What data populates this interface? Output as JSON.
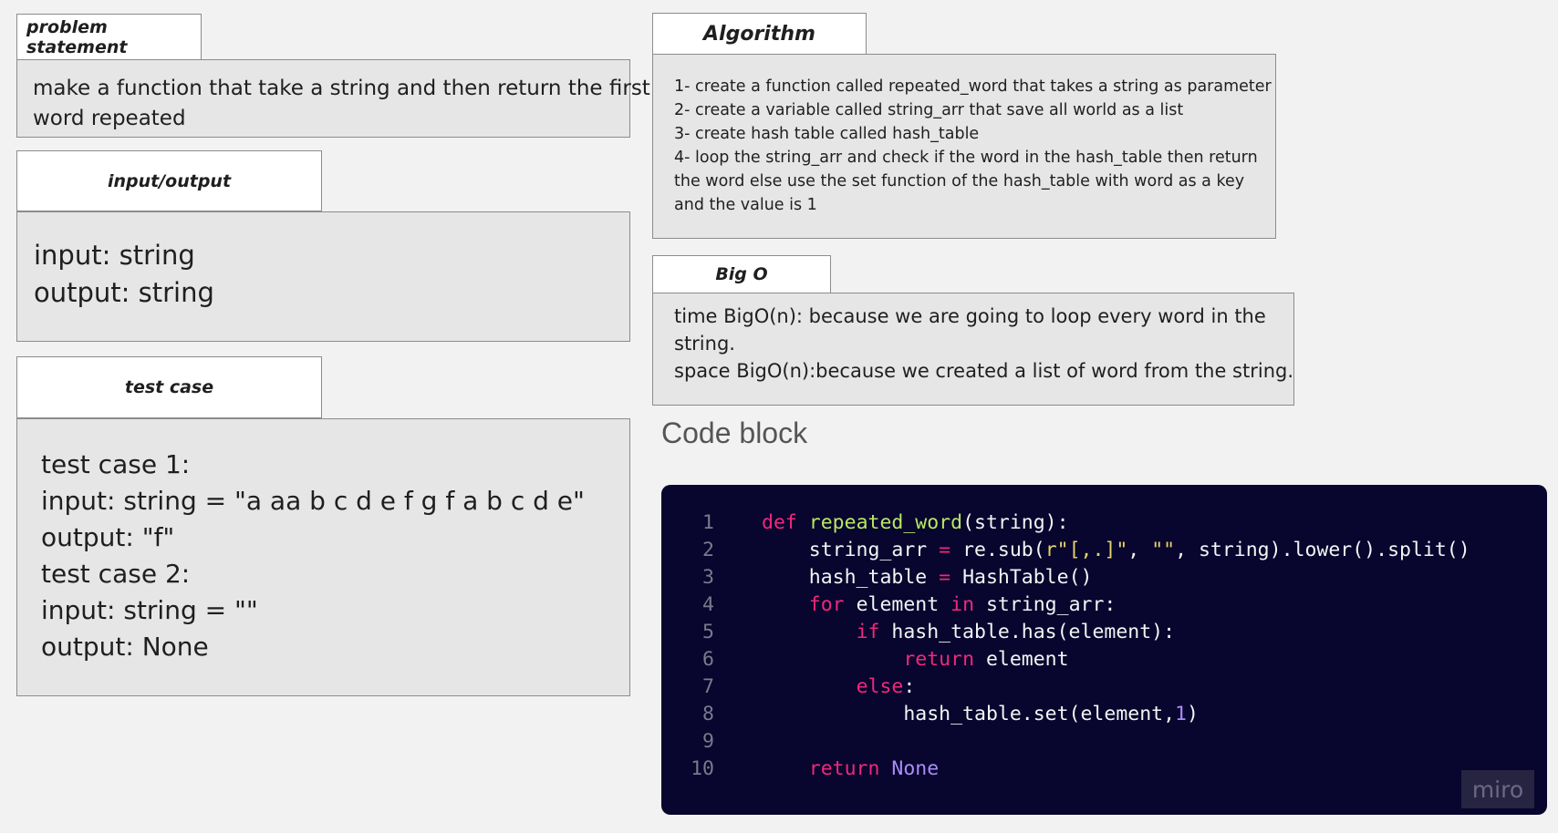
{
  "problem_statement": {
    "title": "problem statement",
    "lines": [
      "make a function that take a string and then return the first",
      "word repeated"
    ]
  },
  "input_output": {
    "title": "input/output",
    "lines": [
      "input: string",
      "output: string"
    ]
  },
  "test_case": {
    "title": "test case",
    "lines": [
      "test case 1:",
      "input: string = \"a aa b c d e f g f a b c d e\"",
      "output: \"f\"",
      "test case 2:",
      "input: string = \"\"",
      "output: None"
    ]
  },
  "algorithm": {
    "title": "Algorithm",
    "lines": [
      "1- create a function called repeated_word that takes a string as parameter",
      "2- create a variable called string_arr that save all world as a list",
      "3- create hash table called hash_table",
      "4- loop the string_arr and check if the word in the hash_table then return",
      "the word else use the set function of the hash_table with word as a key",
      "and the value is 1"
    ]
  },
  "big_o": {
    "title": "Big O",
    "lines": [
      "time BigO(n): because we are going to loop every word in the",
      "string.",
      "space BigO(n):because we created a list of word from the string."
    ]
  },
  "code_block": {
    "heading": "Code block",
    "lines": [
      {
        "no": "1",
        "tokens": [
          {
            "t": "kw",
            "s": "def"
          },
          {
            "t": "plain",
            "s": " "
          },
          {
            "t": "fn",
            "s": "repeated_word"
          },
          {
            "t": "plain",
            "s": "(string):"
          }
        ]
      },
      {
        "no": "2",
        "tokens": [
          {
            "t": "plain",
            "s": "    string_arr "
          },
          {
            "t": "op",
            "s": "="
          },
          {
            "t": "plain",
            "s": " re.sub("
          },
          {
            "t": "str",
            "s": "r\"[,.]\""
          },
          {
            "t": "plain",
            "s": ", "
          },
          {
            "t": "str",
            "s": "\"\""
          },
          {
            "t": "plain",
            "s": ", string).lower().split()"
          }
        ]
      },
      {
        "no": "3",
        "tokens": [
          {
            "t": "plain",
            "s": "    hash_table "
          },
          {
            "t": "op",
            "s": "="
          },
          {
            "t": "plain",
            "s": " HashTable()"
          }
        ]
      },
      {
        "no": "4",
        "tokens": [
          {
            "t": "plain",
            "s": "    "
          },
          {
            "t": "kw",
            "s": "for"
          },
          {
            "t": "plain",
            "s": " element "
          },
          {
            "t": "kw",
            "s": "in"
          },
          {
            "t": "plain",
            "s": " string_arr:"
          }
        ]
      },
      {
        "no": "5",
        "tokens": [
          {
            "t": "plain",
            "s": "        "
          },
          {
            "t": "kw",
            "s": "if"
          },
          {
            "t": "plain",
            "s": " hash_table.has(element):"
          }
        ]
      },
      {
        "no": "6",
        "tokens": [
          {
            "t": "plain",
            "s": "            "
          },
          {
            "t": "kw",
            "s": "return"
          },
          {
            "t": "plain",
            "s": " element"
          }
        ]
      },
      {
        "no": "7",
        "tokens": [
          {
            "t": "plain",
            "s": "        "
          },
          {
            "t": "kw",
            "s": "else"
          },
          {
            "t": "plain",
            "s": ":"
          }
        ]
      },
      {
        "no": "8",
        "tokens": [
          {
            "t": "plain",
            "s": "            hash_table.set(element,"
          },
          {
            "t": "num",
            "s": "1"
          },
          {
            "t": "plain",
            "s": ")"
          }
        ]
      },
      {
        "no": "9",
        "tokens": []
      },
      {
        "no": "10",
        "tokens": [
          {
            "t": "plain",
            "s": "    "
          },
          {
            "t": "kw",
            "s": "return"
          },
          {
            "t": "plain",
            "s": " "
          },
          {
            "t": "num",
            "s": "None"
          }
        ]
      }
    ]
  },
  "watermark": "miro",
  "colors": {
    "background": "#f2f2f2",
    "panel": "#e6e6e6",
    "code_background": "#08052e",
    "keyword": "#f0287a",
    "function_name": "#b8e864",
    "string": "#e6d36a",
    "number": "#ab8cf7"
  }
}
